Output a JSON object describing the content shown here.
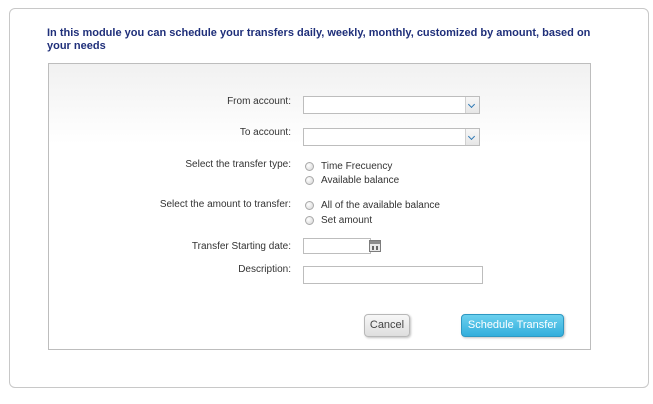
{
  "intro": {
    "text": "In this module you can schedule your transfers daily, weekly, monthly, customized by amount, based on your needs"
  },
  "form": {
    "from_account_label": "From account:",
    "from_account_value": "",
    "to_account_label": "To account:",
    "to_account_value": "",
    "transfer_type_label": "Select the transfer type:",
    "transfer_type_options": [
      "Time Frecuency",
      "Available balance"
    ],
    "amount_label": "Select the amount to transfer:",
    "amount_options": [
      "All of the available balance",
      "Set amount"
    ],
    "start_date_label": "Transfer Starting date:",
    "start_date_value": "",
    "description_label": "Description:",
    "description_value": ""
  },
  "buttons": {
    "cancel_label": "Cancel",
    "schedule_label": "Schedule Transfer"
  },
  "colors": {
    "title": "#1f2f7a",
    "primary_button": "#32aedc",
    "secondary_button": "#dedede"
  },
  "icons": {
    "dropdown": "chevron-down-icon",
    "calendar": "calendar-icon",
    "radio": "radio-button"
  }
}
